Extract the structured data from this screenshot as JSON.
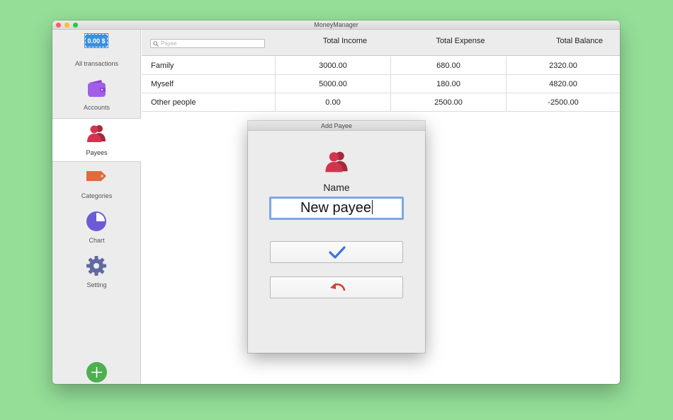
{
  "window": {
    "title": "MoneyManager",
    "traffic_colors": [
      "#fc5f57",
      "#fdbc2e",
      "#29c840"
    ]
  },
  "sidebar": {
    "balance_badge": "0.00 $",
    "items": [
      {
        "label": "All transactions",
        "icon": "balance-badge-icon"
      },
      {
        "label": "Accounts",
        "icon": "wallet-icon",
        "color": "#a25ee8"
      },
      {
        "label": "Payees",
        "icon": "people-icon",
        "color": "#c8324a",
        "active": true
      },
      {
        "label": "Categories",
        "icon": "tag-icon",
        "color": "#e06b3c"
      },
      {
        "label": "Chart",
        "icon": "pie-chart-icon",
        "color": "#6b5bd6"
      },
      {
        "label": "Setting",
        "icon": "gear-icon",
        "color": "#5e6aa0"
      }
    ],
    "add_button": {
      "icon": "plus-icon",
      "color": "#4caf50"
    }
  },
  "header": {
    "search_placeholder": "Payee",
    "columns": [
      "Total Income",
      "Total Expense",
      "Total Balance"
    ]
  },
  "table": {
    "rows": [
      {
        "payee": "Family",
        "income": "3000.00",
        "expense": "680.00",
        "balance": "2320.00"
      },
      {
        "payee": "Myself",
        "income": "5000.00",
        "expense": "180.00",
        "balance": "4820.00"
      },
      {
        "payee": "Other people",
        "income": "0.00",
        "expense": "2500.00",
        "balance": "-2500.00"
      }
    ]
  },
  "dialog": {
    "title": "Add Payee",
    "icon": "people-icon",
    "name_label": "Name",
    "name_value": "New payee",
    "confirm_icon": "checkmark-icon",
    "cancel_icon": "undo-icon"
  }
}
